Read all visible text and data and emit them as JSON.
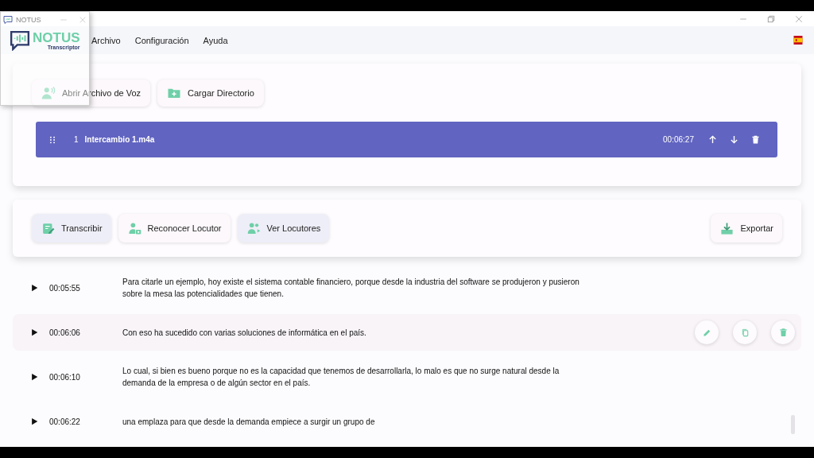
{
  "floating_window": {
    "title": "NOTUS",
    "logo": {
      "name": "NOTUS",
      "subtitle": "Transcriptor"
    }
  },
  "menu": [
    "Archivo",
    "Configuración",
    "Ayuda"
  ],
  "file_actions": [
    {
      "label": "Abrir Archivo de Voz",
      "kind": "voice"
    },
    {
      "label": "Cargar Directorio",
      "kind": "folder"
    }
  ],
  "files": [
    {
      "index": "1",
      "name": "Intercambio 1.m4a",
      "duration": "00:06:27"
    }
  ],
  "tools": [
    {
      "label": "Transcribir",
      "kind": "transcribe",
      "selected": true
    },
    {
      "label": "Reconocer Locutor",
      "kind": "recognize",
      "selected": false
    },
    {
      "label": "Ver Locutores",
      "kind": "speakers",
      "selected": true
    }
  ],
  "export": {
    "label": "Exportar"
  },
  "segments": [
    {
      "time": "00:05:55",
      "text": "Para citarle un ejemplo, hoy existe el sistema contable financiero, porque desde la industria del software se produjeron y pusieron sobre la mesa las potencialidades que tienen.",
      "hovered": false
    },
    {
      "time": "00:06:06",
      "text": "Con eso ha sucedido con varias soluciones de informática en el país.",
      "hovered": true
    },
    {
      "time": "00:06:10",
      "text": "Lo cual, si bien es bueno porque no es la capacidad que tenemos de desarrollarla, lo malo es que no surge natural desde la demanda de la empresa o de algún sector en el país.",
      "hovered": false
    },
    {
      "time": "00:06:22",
      "text": "una emplaza para que desde la demanda empiece a surgir un grupo de",
      "hovered": false
    }
  ]
}
